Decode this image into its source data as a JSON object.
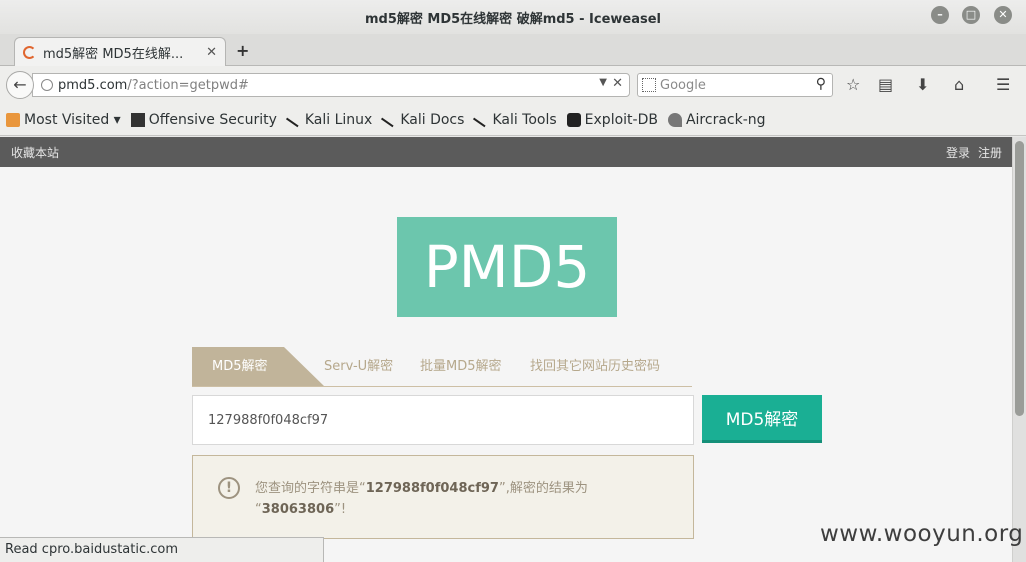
{
  "window": {
    "title": "md5解密 MD5在线解密 破解md5 - Iceweasel"
  },
  "tab": {
    "label": "md5解密 MD5在线解...",
    "close": "✕"
  },
  "newtab": "+",
  "nav": {
    "url_host": "pmd5.com",
    "url_path": "/?action=getpwd#",
    "search_placeholder": "Google"
  },
  "bookmarks": [
    {
      "label": "Most Visited ▾",
      "icon": "folder-icon"
    },
    {
      "label": "Offensive Security",
      "icon": "dragon-icon"
    },
    {
      "label": "Kali Linux",
      "icon": "kali-icon"
    },
    {
      "label": "Kali Docs",
      "icon": "kali-icon"
    },
    {
      "label": "Kali Tools",
      "icon": "kali-icon"
    },
    {
      "label": "Exploit-DB",
      "icon": "exploit-db-icon"
    },
    {
      "label": "Aircrack-ng",
      "icon": "aircrack-icon"
    }
  ],
  "site": {
    "favorite": "收藏本站",
    "login": "登录",
    "register": "注册",
    "logo": "PMD5",
    "tabs": [
      "MD5解密",
      "Serv-U解密",
      "批量MD5解密",
      "找回其它网站历史密码"
    ],
    "input_value": "127988f0f048cf97",
    "button_label": "MD5解密",
    "result": {
      "prefix": "您查询的字符串是“",
      "query": "127988f0f048cf97",
      "middle": "”,解密的结果为",
      "open": "“",
      "answer": "38063806",
      "close": "”!"
    }
  },
  "status": "Read cpro.baidustatic.com",
  "watermark": "www.wooyun.org",
  "colors": {
    "logo_bg": "#6cc6ad",
    "button_bg": "#1aaf94",
    "active_tab": "#c1b49a",
    "topstrip": "#5b5b5b"
  }
}
